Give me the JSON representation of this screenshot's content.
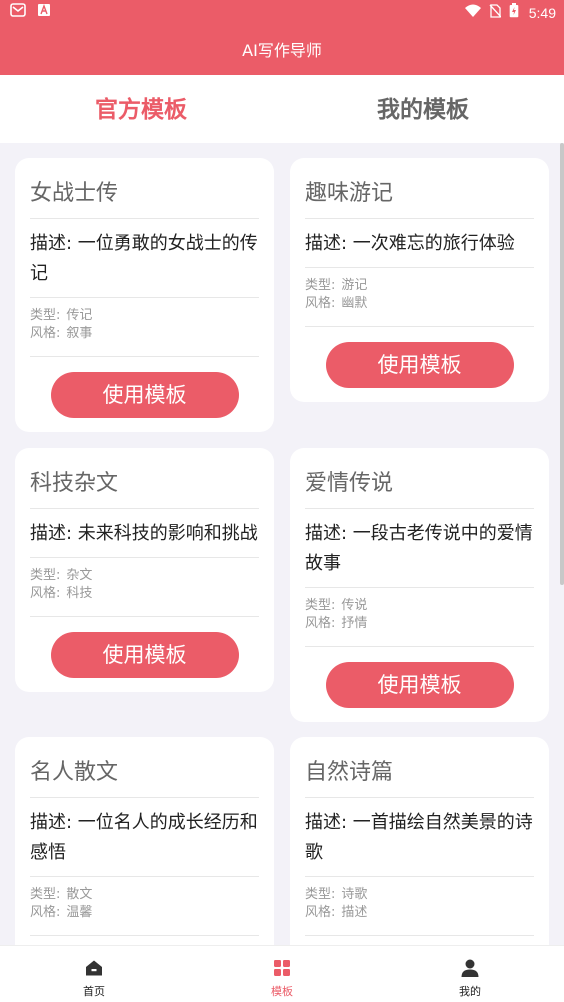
{
  "status_bar": {
    "time": "5:49",
    "left_icons": [
      "mail-icon",
      "a-badge-icon"
    ],
    "right_icons": [
      "wifi-icon",
      "no-sim-icon",
      "battery-icon"
    ]
  },
  "app_title": "AI写作导师",
  "tabs": [
    {
      "label": "官方模板",
      "active": true
    },
    {
      "label": "我的模板",
      "active": false
    }
  ],
  "labels": {
    "type": "类型:",
    "style": "风格:",
    "use_button": "使用模板"
  },
  "templates": [
    {
      "title": "女战士传",
      "description": "描述: 一位勇敢的女战士的传记",
      "type": "传记",
      "style": "叙事"
    },
    {
      "title": "趣味游记",
      "description": "描述: 一次难忘的旅行体验",
      "type": "游记",
      "style": "幽默"
    },
    {
      "title": "科技杂文",
      "description": "描述: 未来科技的影响和挑战",
      "type": "杂文",
      "style": "科技"
    },
    {
      "title": "爱情传说",
      "description": "描述: 一段古老传说中的爱情故事",
      "type": "传说",
      "style": "抒情"
    },
    {
      "title": "名人散文",
      "description": "描述: 一位名人的成长经历和感悟",
      "type": "散文",
      "style": "温馨"
    },
    {
      "title": "自然诗篇",
      "description": "描述: 一首描绘自然美景的诗歌",
      "type": "诗歌",
      "style": "描述"
    }
  ],
  "bottom_nav": [
    {
      "label": "首页",
      "icon": "home-icon",
      "active": false
    },
    {
      "label": "模板",
      "icon": "grid-icon",
      "active": true
    },
    {
      "label": "我的",
      "icon": "person-icon",
      "active": false
    }
  ],
  "colors": {
    "accent": "#eb5c68",
    "background": "#f3f2f8",
    "card": "#ffffff"
  }
}
